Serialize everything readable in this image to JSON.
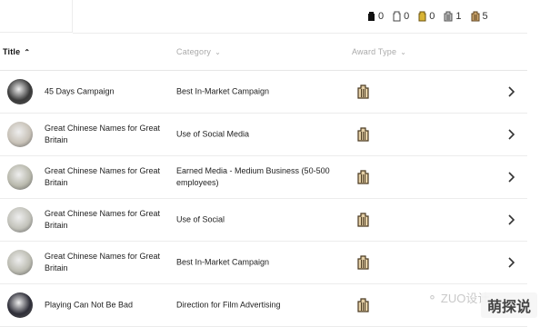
{
  "award_summary": [
    {
      "icon": "black-pencil-icon",
      "color": "#111111",
      "count": "0"
    },
    {
      "icon": "white-pencil-icon",
      "color": "#555555",
      "count": "0"
    },
    {
      "icon": "yellow-pencil-icon",
      "color": "#8a6d12",
      "count": "0"
    },
    {
      "icon": "graphite-pencil-icon",
      "color": "#666666",
      "count": "1"
    },
    {
      "icon": "wood-pencil-icon",
      "color": "#7a5a2a",
      "count": "5"
    }
  ],
  "columns": {
    "title": "Title",
    "category": "Category",
    "award_type": "Award Type"
  },
  "rows": [
    {
      "title": "45 Days Campaign",
      "category": "Best In-Market Campaign",
      "thumb_color": "#3a3a3a"
    },
    {
      "title": "Great Chinese Names for Great Britain",
      "category": "Use of Social Media",
      "thumb_color": "#c8c2b8"
    },
    {
      "title": "Great Chinese Names for Great Britain",
      "category": "Earned Media - Medium Business (50-500 employees)",
      "thumb_color": "#b9b9ad"
    },
    {
      "title": "Great Chinese Names for Great Britain",
      "category": "Use of Social",
      "thumb_color": "#c2c2ba"
    },
    {
      "title": "Great Chinese Names for Great Britain",
      "category": "Best In-Market Campaign",
      "thumb_color": "#bdbdb3"
    },
    {
      "title": "Playing Can Not Be Bad",
      "category": "Direction for Film Advertising",
      "thumb_color": "#2e2e38"
    }
  ],
  "award_icon": "wood-pencil-icon",
  "watermark": {
    "text": "ZUO设计",
    "badge": "萌探说"
  }
}
